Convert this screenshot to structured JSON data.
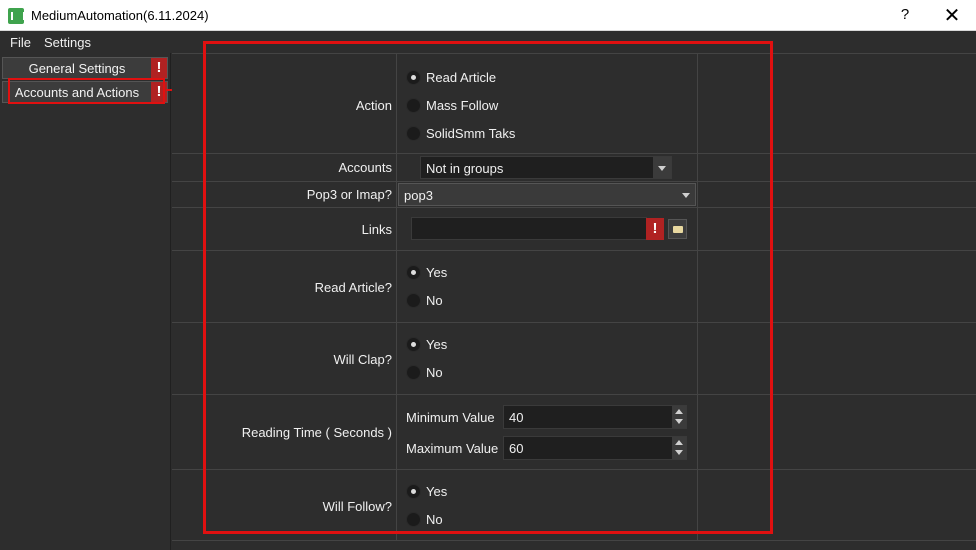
{
  "window": {
    "title": "MediumAutomation(6.11.2024)",
    "help": "?",
    "close": "✕"
  },
  "menu": {
    "file": "File",
    "settings": "Settings"
  },
  "sidebar": {
    "items": [
      {
        "label": "General Settings",
        "warning": "!"
      },
      {
        "label": "Accounts and Actions",
        "warning": "!"
      }
    ]
  },
  "form": {
    "action": {
      "label": "Action",
      "options": [
        "Read Article",
        "Mass Follow",
        "SolidSmm Taks"
      ],
      "selected": "Read Article"
    },
    "accounts": {
      "label": "Accounts",
      "value": "Not in groups"
    },
    "pop3": {
      "label": "Pop3 or Imap?",
      "value": "pop3"
    },
    "links": {
      "label": "Links",
      "value": "",
      "warning": "!"
    },
    "read_article": {
      "label": "Read Article?",
      "options": [
        "Yes",
        "No"
      ],
      "selected": "Yes"
    },
    "will_clap": {
      "label": "Will Clap?",
      "options": [
        "Yes",
        "No"
      ],
      "selected": "Yes"
    },
    "reading_time": {
      "label": "Reading Time ( Seconds )",
      "min_label": "Minimum Value",
      "min_value": "40",
      "max_label": "Maximum Value",
      "max_value": "60"
    },
    "will_follow": {
      "label": "Will Follow?",
      "options": [
        "Yes",
        "No"
      ],
      "selected": "Yes"
    }
  },
  "colors": {
    "background": "#2d2d2d",
    "annotation_red": "#e01010",
    "warning_red": "#b02222"
  }
}
